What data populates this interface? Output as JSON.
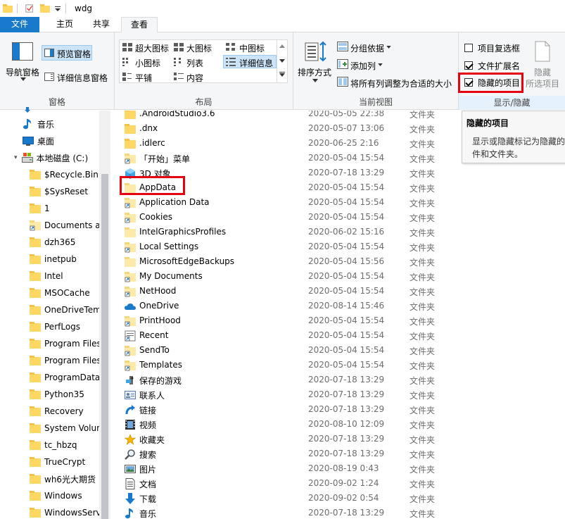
{
  "window": {
    "title": "wdg"
  },
  "tabs": [
    {
      "label": "文件"
    },
    {
      "label": "主页"
    },
    {
      "label": "共享"
    },
    {
      "label": "查看"
    }
  ],
  "ribbon": {
    "panes": {
      "nav_pane": "导航窗格",
      "preview_pane": "预览窗格",
      "details_pane": "详细信息窗格",
      "label": "窗格"
    },
    "layout": {
      "extra_large": "超大图标",
      "large": "大图标",
      "medium": "中图标",
      "small": "小图标",
      "list": "列表",
      "details": "详细信息",
      "tiles": "平铺",
      "content": "内容",
      "label": "布局"
    },
    "current_view": {
      "sort_by": "排序方式",
      "group_by": "分组依据",
      "add_columns": "添加列",
      "size_all": "将所有列调整为合适的大小",
      "label": "当前视图"
    },
    "show_hide": {
      "item_checkboxes": "项目复选框",
      "item_checkboxes_checked": false,
      "file_extensions": "文件扩展名",
      "file_extensions_checked": true,
      "hidden_items": "隐藏的项目",
      "hidden_items_checked": true,
      "hide_selected_line1": "隐藏",
      "hide_selected_line2": "所选项目",
      "label": "显示/隐藏"
    }
  },
  "tooltip": {
    "title": "隐藏的项目",
    "body_line1": "显示或隐藏标记为隐藏的",
    "body_line2": "件和文件夹。"
  },
  "nav": [
    {
      "label": "音乐",
      "icon": "music-icon"
    },
    {
      "label": "桌面",
      "icon": "desktop-icon"
    },
    {
      "label": "本地磁盘 (C:)",
      "icon": "drive-icon"
    },
    {
      "label": "$Recycle.Bin",
      "icon": "folder-icon"
    },
    {
      "label": "$SysReset",
      "icon": "folder-icon"
    },
    {
      "label": "1",
      "icon": "folder-icon"
    },
    {
      "label": "Documents ar",
      "icon": "shortcut-folder-icon"
    },
    {
      "label": "dzh365",
      "icon": "folder-icon"
    },
    {
      "label": "inetpub",
      "icon": "folder-icon"
    },
    {
      "label": "Intel",
      "icon": "folder-icon"
    },
    {
      "label": "MSOCache",
      "icon": "folder-icon"
    },
    {
      "label": "OneDriveTem",
      "icon": "folder-icon"
    },
    {
      "label": "PerfLogs",
      "icon": "folder-icon"
    },
    {
      "label": "Program Files",
      "icon": "folder-icon"
    },
    {
      "label": "Program Files",
      "icon": "folder-icon"
    },
    {
      "label": "ProgramData",
      "icon": "folder-icon"
    },
    {
      "label": "Python35",
      "icon": "folder-icon"
    },
    {
      "label": "Recovery",
      "icon": "folder-icon"
    },
    {
      "label": "System Volun",
      "icon": "folder-icon"
    },
    {
      "label": "tc_hbzq",
      "icon": "folder-icon"
    },
    {
      "label": "TrueCrypt",
      "icon": "folder-icon"
    },
    {
      "label": "wh6光大期货",
      "icon": "folder-icon"
    },
    {
      "label": "Windows",
      "icon": "folder-icon"
    },
    {
      "label": "WindowsServ",
      "icon": "folder-icon"
    }
  ],
  "files": [
    {
      "name": ".AndroidStudio3.6",
      "date": "2020-05-05 22:38",
      "type": "文件夹",
      "icon": "folder-icon"
    },
    {
      "name": ".dnx",
      "date": "2020-05-07 13:06",
      "type": "文件夹",
      "icon": "folder-icon"
    },
    {
      "name": ".idlerc",
      "date": "2020-06-25 2:16",
      "type": "文件夹",
      "icon": "folder-icon"
    },
    {
      "name": "「开始」菜单",
      "date": "2020-05-04 15:54",
      "type": "文件夹",
      "icon": "shortcut-folder-icon"
    },
    {
      "name": "3D 对象",
      "date": "2020-07-18 13:29",
      "type": "文件夹",
      "icon": "3d-objects-icon"
    },
    {
      "name": "AppData",
      "date": "2020-05-04 15:54",
      "type": "文件夹",
      "icon": "hidden-folder-icon"
    },
    {
      "name": "Application Data",
      "date": "2020-05-04 15:54",
      "type": "文件夹",
      "icon": "shortcut-folder-icon"
    },
    {
      "name": "Cookies",
      "date": "2020-05-04 15:54",
      "type": "文件夹",
      "icon": "shortcut-folder-icon"
    },
    {
      "name": "IntelGraphicsProfiles",
      "date": "2020-06-02 15:16",
      "type": "文件夹",
      "icon": "hidden-folder-icon"
    },
    {
      "name": "Local Settings",
      "date": "2020-05-04 15:54",
      "type": "文件夹",
      "icon": "shortcut-folder-icon"
    },
    {
      "name": "MicrosoftEdgeBackups",
      "date": "2020-05-04 15:56",
      "type": "文件夹",
      "icon": "hidden-folder-icon"
    },
    {
      "name": "My Documents",
      "date": "2020-05-04 15:54",
      "type": "文件夹",
      "icon": "shortcut-folder-icon"
    },
    {
      "name": "NetHood",
      "date": "2020-05-04 15:54",
      "type": "文件夹",
      "icon": "shortcut-folder-icon"
    },
    {
      "name": "OneDrive",
      "date": "2020-08-14 15:46",
      "type": "文件夹",
      "icon": "onedrive-icon"
    },
    {
      "name": "PrintHood",
      "date": "2020-05-04 15:54",
      "type": "文件夹",
      "icon": "shortcut-folder-icon"
    },
    {
      "name": "Recent",
      "date": "2020-05-04 15:54",
      "type": "文件夹",
      "icon": "recent-icon"
    },
    {
      "name": "SendTo",
      "date": "2020-05-04 15:54",
      "type": "文件夹",
      "icon": "shortcut-folder-icon"
    },
    {
      "name": "Templates",
      "date": "2020-05-04 15:54",
      "type": "文件夹",
      "icon": "shortcut-folder-icon"
    },
    {
      "name": "保存的游戏",
      "date": "2020-07-18 13:29",
      "type": "文件夹",
      "icon": "saved-games-icon"
    },
    {
      "name": "联系人",
      "date": "2020-07-18 13:29",
      "type": "文件夹",
      "icon": "contacts-icon"
    },
    {
      "name": "链接",
      "date": "2020-07-18 13:29",
      "type": "文件夹",
      "icon": "links-icon"
    },
    {
      "name": "视频",
      "date": "2020-08-10 12:09",
      "type": "文件夹",
      "icon": "videos-icon"
    },
    {
      "name": "收藏夹",
      "date": "2020-07-18 13:29",
      "type": "文件夹",
      "icon": "favorites-icon"
    },
    {
      "name": "搜索",
      "date": "2020-07-18 13:29",
      "type": "文件夹",
      "icon": "searches-icon"
    },
    {
      "name": "图片",
      "date": "2020-08-19 0:43",
      "type": "文件夹",
      "icon": "pictures-icon"
    },
    {
      "name": "文档",
      "date": "2020-09-02 1:24",
      "type": "文件夹",
      "icon": "documents-icon"
    },
    {
      "name": "下载",
      "date": "2020-09-02 0:54",
      "type": "文件夹",
      "icon": "downloads-icon"
    },
    {
      "name": "音乐",
      "date": "2020-07-18 13:29",
      "type": "文件夹",
      "icon": "music-icon"
    }
  ]
}
